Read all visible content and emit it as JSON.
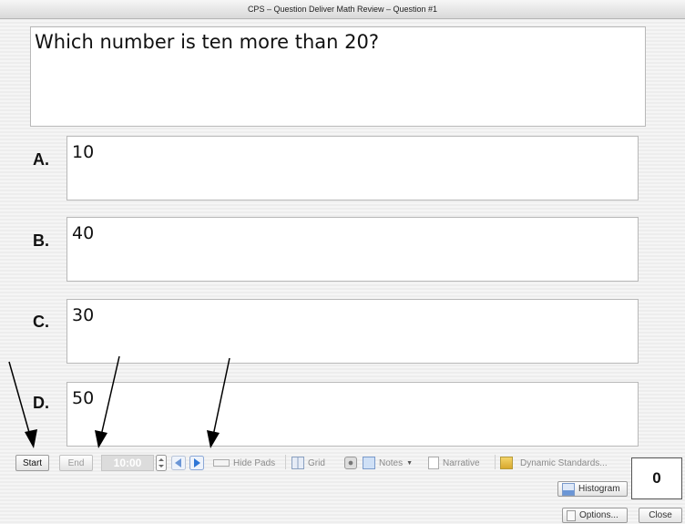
{
  "window": {
    "title": "CPS – Question Deliver Math Review – Question #1"
  },
  "question": {
    "text": "Which number is ten more than 20?"
  },
  "answers": [
    {
      "letter": "A.",
      "text": "10"
    },
    {
      "letter": "B.",
      "text": "40"
    },
    {
      "letter": "C.",
      "text": "30"
    },
    {
      "letter": "D.",
      "text": "50"
    }
  ],
  "toolbar": {
    "start": "Start",
    "end": "End",
    "timer": "10:00",
    "hide_pads": "Hide Pads",
    "grid": "Grid",
    "notes": "Notes",
    "narrative": "Narrative",
    "dynamic_standards": "Dynamic Standards..."
  },
  "response_count": "0",
  "bottom": {
    "histogram": "Histogram",
    "options": "Options...",
    "close": "Close"
  }
}
